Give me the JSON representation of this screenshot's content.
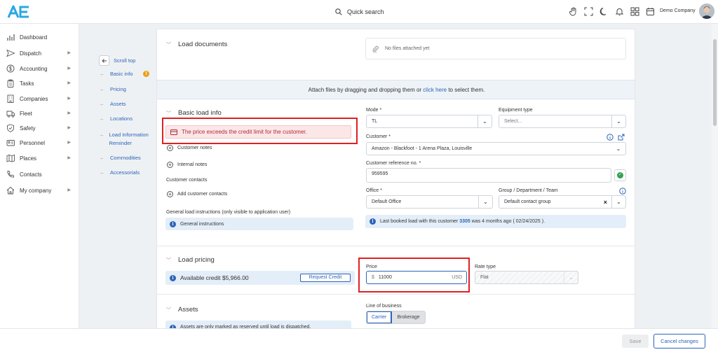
{
  "header": {
    "logo_text": "AE",
    "search_label": "Quick search",
    "company_name": "Demo Company",
    "icons": [
      "hand-icon",
      "fullscreen-icon",
      "moon-icon",
      "bell-icon",
      "apps-grid-icon",
      "calendar-icon"
    ]
  },
  "sidebar": {
    "items": [
      {
        "label": "Dashboard",
        "icon": "chart-icon",
        "chevron": false
      },
      {
        "label": "Dispatch",
        "icon": "send-icon",
        "chevron": true
      },
      {
        "label": "Accounting",
        "icon": "dollar-icon",
        "chevron": true
      },
      {
        "label": "Tasks",
        "icon": "clipboard-icon",
        "chevron": true
      },
      {
        "label": "Companies",
        "icon": "building-icon",
        "chevron": true
      },
      {
        "label": "Fleet",
        "icon": "truck-icon",
        "chevron": true
      },
      {
        "label": "Safety",
        "icon": "shield-icon",
        "chevron": true
      },
      {
        "label": "Personnel",
        "icon": "id-card-icon",
        "chevron": true
      },
      {
        "label": "Places",
        "icon": "map-icon",
        "chevron": true
      },
      {
        "label": "Contacts",
        "icon": "phone-icon",
        "chevron": false
      },
      {
        "label": "My company",
        "icon": "home-icon",
        "chevron": true
      }
    ]
  },
  "subnav": {
    "scroll_top": "Scroll top",
    "items": [
      "Basic info",
      "Pricing",
      "Assets",
      "Locations",
      "Load Information Reminder",
      "Commodities",
      "Accessorials"
    ],
    "warning_badge": "!"
  },
  "load_documents": {
    "title": "Load documents",
    "no_files": "No files attached yet",
    "attach_prefix": "Attach files by dragging and dropping them or ",
    "attach_link": "click here",
    "attach_suffix": " to select them."
  },
  "basic_info": {
    "title": "Basic load info",
    "alert": "The price exceeds the credit limit for the customer.",
    "customer_notes": "Customer notes",
    "internal_notes": "Internal notes",
    "customer_contacts_label": "Customer contacts",
    "add_contacts": "Add customer contacts",
    "general_instructions_label": "General load instructions (only visible to application user)",
    "general_instructions": "General instructions",
    "mode_label": "Mode *",
    "mode_value": "TL",
    "equipment_label": "Equipment type",
    "equipment_placeholder": "Select...",
    "customer_label": "Customer *",
    "customer_value": "Amazon - Blackfoot - 1 Arena Plaza, Louisville",
    "ref_label": "Customer reference no. *",
    "ref_value": "959595",
    "office_label": "Office *",
    "office_value": "Default Office",
    "group_label": "Group / Department / Team",
    "group_value": "Default contact group",
    "last_booked_prefix": "Last booked load with this customer ",
    "last_booked_link": "3305",
    "last_booked_suffix": " was 4 months ago ( 02/24/2025 )."
  },
  "pricing": {
    "title": "Load pricing",
    "available_credit": "Available credit $5,966.00",
    "request_credit": "Request Credit",
    "price_label": "Price",
    "price_symbol": "$",
    "price_value": "11000",
    "price_currency": "USD",
    "rate_type_label": "Rate type",
    "rate_type_value": "Flat"
  },
  "assets": {
    "title": "Assets",
    "note": "Assets are only marked as reserved until load is dispatched.",
    "lob_label": "Line of business",
    "lob_options": [
      "Carrier",
      "Brokerage"
    ]
  },
  "footer": {
    "save": "Save",
    "cancel": "Cancel changes"
  }
}
